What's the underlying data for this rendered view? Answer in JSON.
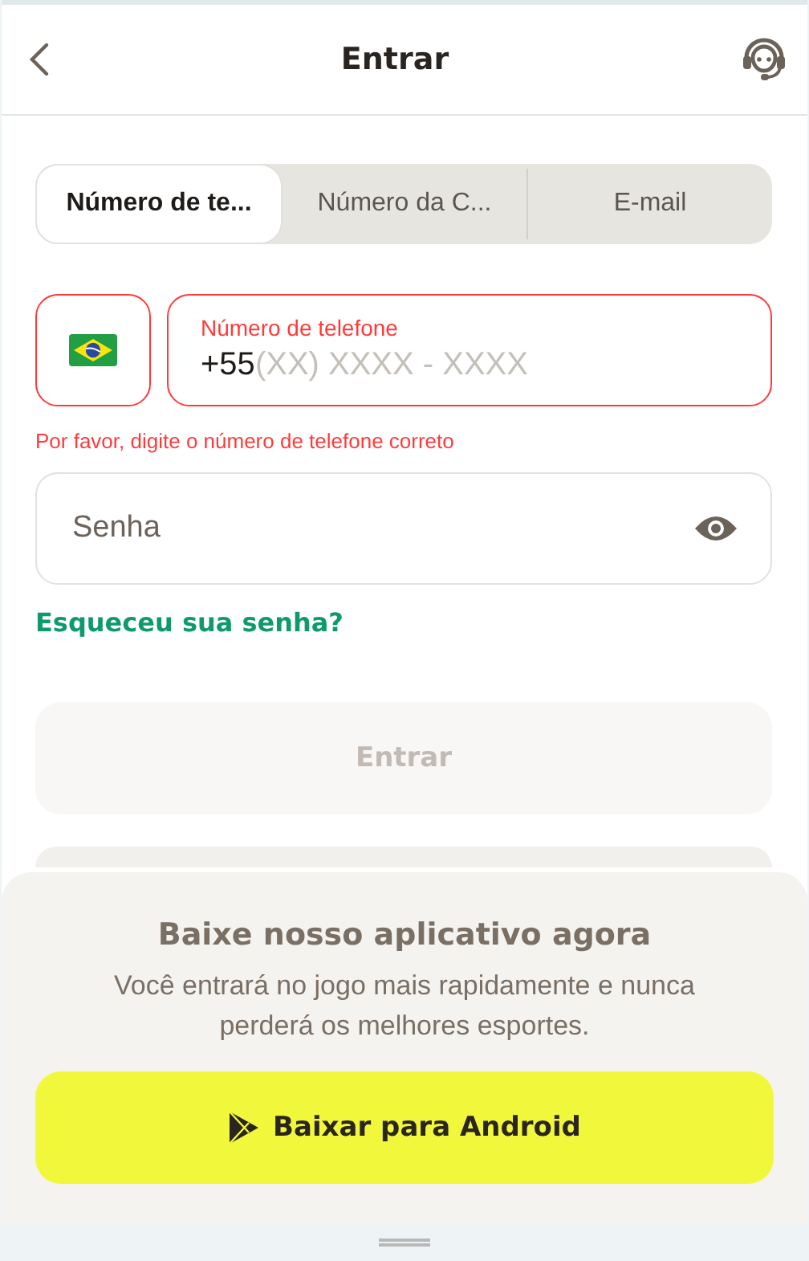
{
  "header": {
    "title": "Entrar"
  },
  "tabs": [
    {
      "label": "Número de te...",
      "selected": true
    },
    {
      "label": "Número da C...",
      "selected": false
    },
    {
      "label": "E-mail",
      "selected": false
    }
  ],
  "phone": {
    "label": "Número de telefone",
    "prefix": "+55",
    "placeholder": "(XX) XXXX - XXXX",
    "invalid": true,
    "error": "Por favor, digite o número de telefone correto"
  },
  "password": {
    "placeholder": "Senha"
  },
  "forgot_link": "Esqueceu sua senha?",
  "login_button": {
    "label": "Entrar",
    "disabled": true
  },
  "app_promo": {
    "title": "Baixe nosso aplicativo agora",
    "text": "Você entrará no jogo mais rapidamente e nunca perderá os melhores esportes.",
    "button": "Baixar para Android"
  }
}
